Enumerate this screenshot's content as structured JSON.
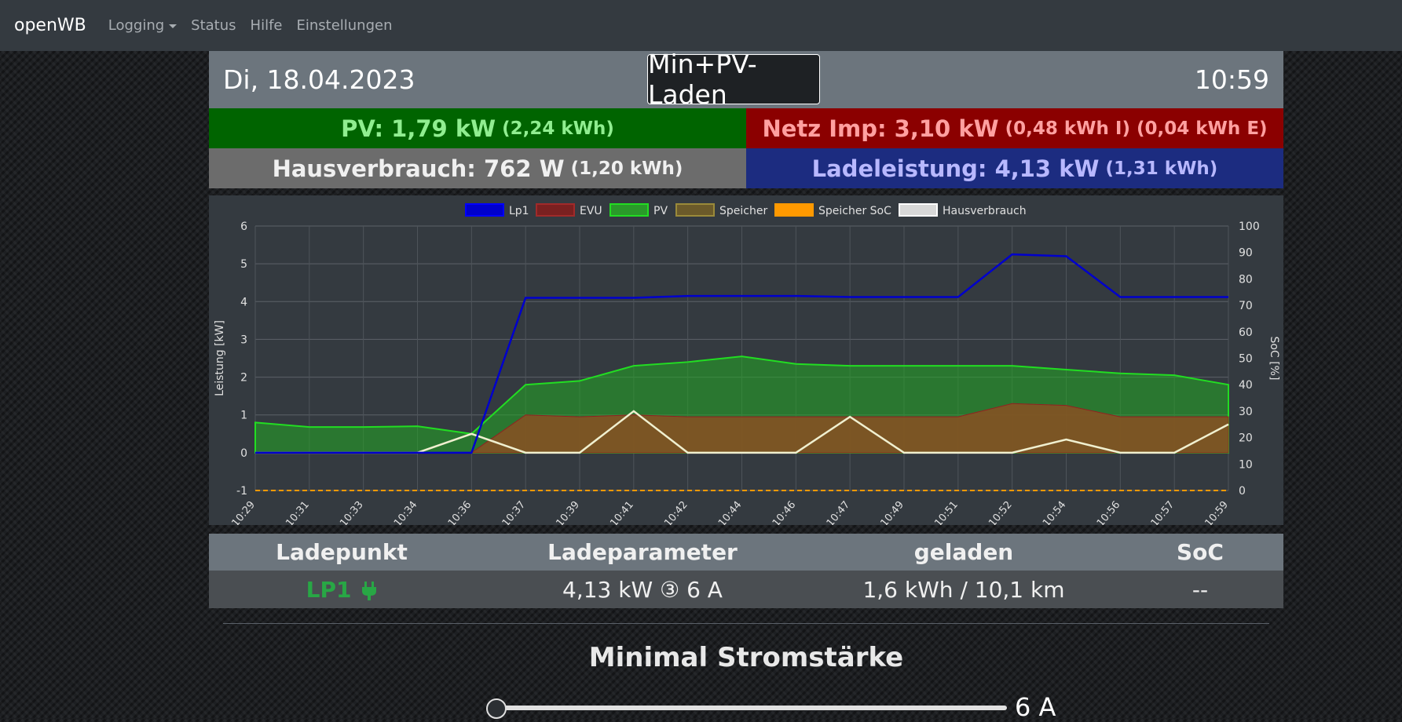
{
  "nav": {
    "brand": "openWB",
    "items": [
      "Logging",
      "Status",
      "Hilfe",
      "Einstellungen"
    ]
  },
  "header": {
    "date": "Di, 18.04.2023",
    "mode": "Min+PV-Laden",
    "time": "10:59"
  },
  "tiles": {
    "pv_label": "PV: 1,79 kW",
    "pv_sub": "(2,24 kWh)",
    "netz_label": "Netz Imp: 3,10 kW",
    "netz_sub": "(0,48 kWh I) (0,04 kWh E)",
    "haus_label": "Hausverbrauch: 762 W",
    "haus_sub": "(1,20 kWh)",
    "lade_label": "Ladeleistung: 4,13 kW",
    "lade_sub": "(1,31 kWh)"
  },
  "colors": {
    "lp1": "#0000cc",
    "evu": "#8b2222",
    "pv": "#22aa22",
    "speicher": "#8b6d22",
    "speicher_soc": "#ff9900",
    "hausverbrauch": "#e0e0e0"
  },
  "chart_data": {
    "type": "line",
    "xlabel": "",
    "ylabel": "Leistung [kW]",
    "y2label": "SoC [%]",
    "ylim": [
      -1,
      6
    ],
    "y2lim": [
      0,
      100
    ],
    "yticks": [
      "-1",
      "0",
      "1",
      "2",
      "3",
      "4",
      "5",
      "6"
    ],
    "y2ticks": [
      "0",
      "10",
      "20",
      "30",
      "40",
      "50",
      "60",
      "70",
      "80",
      "90",
      "100"
    ],
    "categories": [
      "10:29",
      "10:31",
      "10:33",
      "10:34",
      "10:36",
      "10:37",
      "10:39",
      "10:41",
      "10:42",
      "10:44",
      "10:46",
      "10:47",
      "10:49",
      "10:51",
      "10:52",
      "10:54",
      "10:56",
      "10:57",
      "10:59"
    ],
    "legend": [
      "Lp1",
      "EVU",
      "PV",
      "Speicher",
      "Speicher SoC",
      "Hausverbrauch"
    ],
    "grid": true,
    "series": [
      {
        "name": "Lp1",
        "values": [
          0,
          0,
          0,
          0,
          0,
          4.1,
          4.1,
          4.1,
          4.15,
          4.15,
          4.15,
          4.12,
          4.12,
          4.12,
          5.25,
          5.2,
          4.12,
          4.12,
          4.12
        ]
      },
      {
        "name": "EVU",
        "values": [
          0,
          0,
          0,
          0,
          0,
          1.0,
          0.95,
          1.0,
          0.95,
          0.95,
          0.95,
          0.95,
          0.95,
          0.95,
          1.3,
          1.25,
          0.95,
          0.95,
          0.95
        ]
      },
      {
        "name": "PV",
        "values": [
          0.8,
          0.68,
          0.68,
          0.7,
          0.5,
          1.8,
          1.9,
          2.3,
          2.4,
          2.55,
          2.35,
          2.3,
          2.3,
          2.3,
          2.3,
          2.2,
          2.1,
          2.05,
          1.8
        ]
      },
      {
        "name": "Speicher",
        "values": [
          0,
          0,
          0,
          0,
          0,
          1.0,
          0.95,
          1.0,
          0.95,
          0.95,
          0.95,
          0.95,
          0.95,
          0.95,
          1.3,
          1.25,
          0.95,
          0.95,
          0.95
        ]
      },
      {
        "name": "Speicher SoC",
        "values": [
          0,
          0,
          0,
          0,
          0,
          0,
          0,
          0,
          0,
          0,
          0,
          0,
          0,
          0,
          0,
          0,
          0,
          0,
          0
        ]
      },
      {
        "name": "Hausverbrauch",
        "values": [
          0,
          0,
          0,
          0,
          0.5,
          0,
          0,
          1.1,
          0,
          0,
          0,
          0.95,
          0,
          0,
          0,
          0.35,
          0,
          0,
          0.75
        ]
      }
    ]
  },
  "table": {
    "headers": [
      "Ladepunkt",
      "Ladeparameter",
      "geladen",
      "SoC"
    ],
    "row": {
      "name": "LP1",
      "params": "4,13 kW ③ 6 A",
      "charged": "1,6 kWh / 10,1 km",
      "soc": "--"
    }
  },
  "min_current": {
    "title": "Minimal Stromstärke",
    "value": "6 A",
    "level": 0
  }
}
